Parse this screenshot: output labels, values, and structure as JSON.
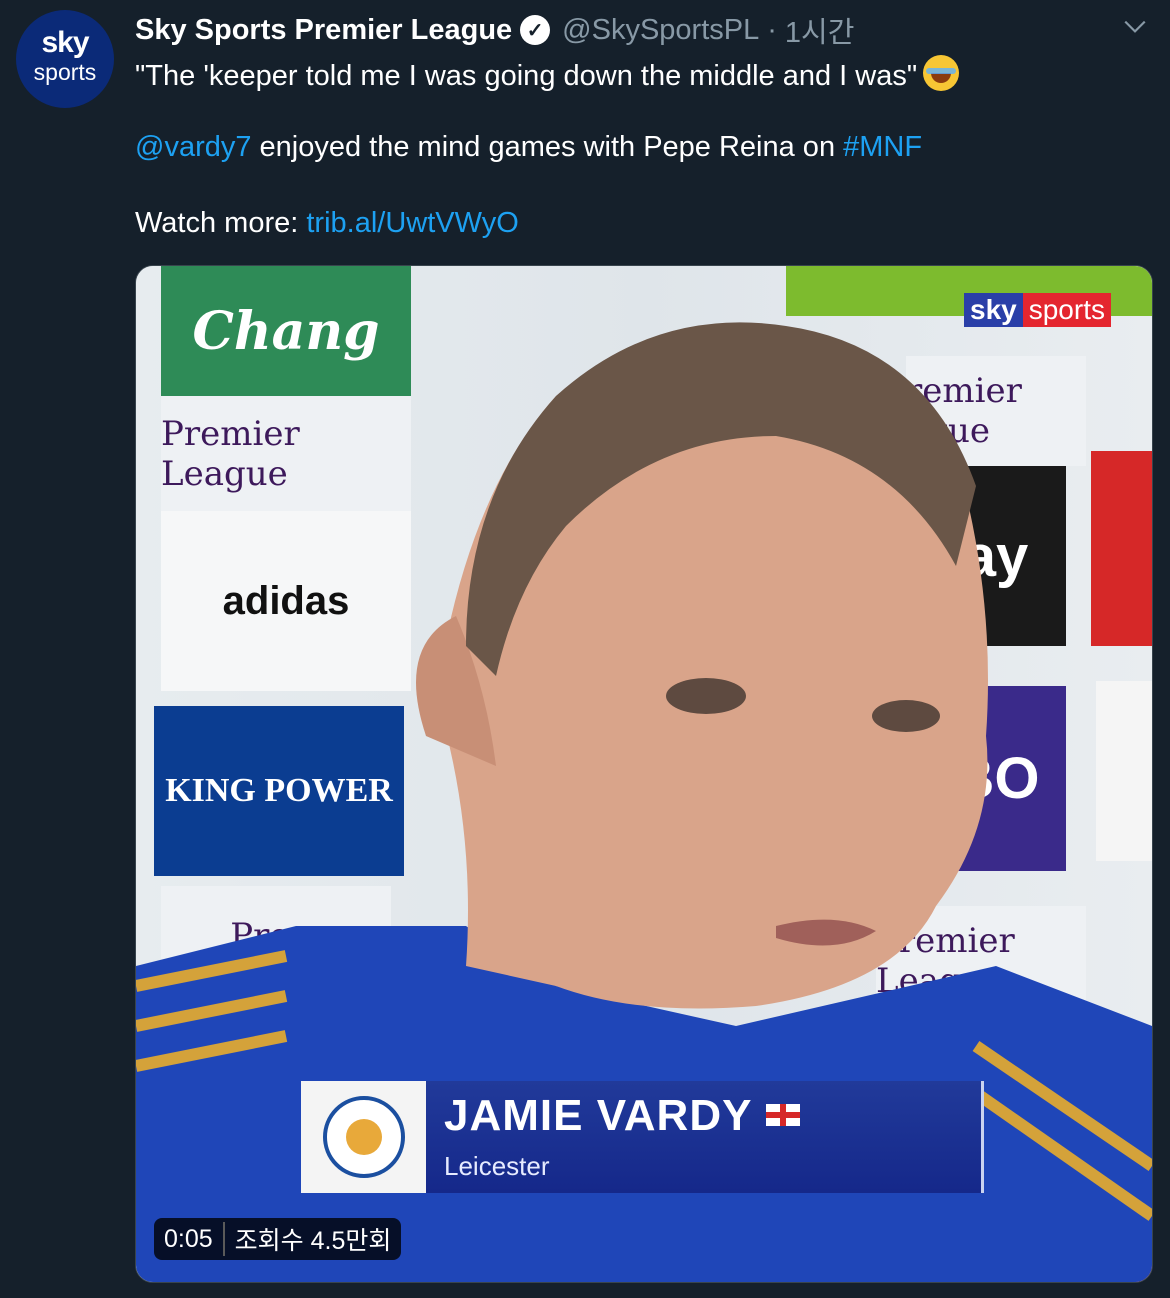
{
  "account": {
    "avatar_line1": "sky",
    "avatar_line2": "sports",
    "name": "Sky Sports Premier League",
    "verified_glyph": "✓",
    "handle": "@SkySportsPL",
    "separator": "·",
    "time": "1시간"
  },
  "tweet": {
    "line1": "\"The 'keeper told me I was going down the middle and I was\"",
    "emoji": "face-with-tears-of-joy",
    "mention": "@vardy7",
    "line2_text": " enjoyed the mind games with Pepe Reina on ",
    "hashtag": "#MNF",
    "watch_label": "Watch more: ",
    "watch_link": "trib.al/UwtVWyO"
  },
  "video": {
    "broadcaster_sky": "sky",
    "broadcaster_sports": "sports",
    "player_name": "JAMIE VARDY",
    "player_club": "Leicester",
    "time": "0:05",
    "views": "조회수 4.5만회"
  },
  "colors": {
    "background": "#15202b",
    "link": "#1da1f2",
    "muted": "#8899a6",
    "lower_third": "#1a2f92"
  }
}
